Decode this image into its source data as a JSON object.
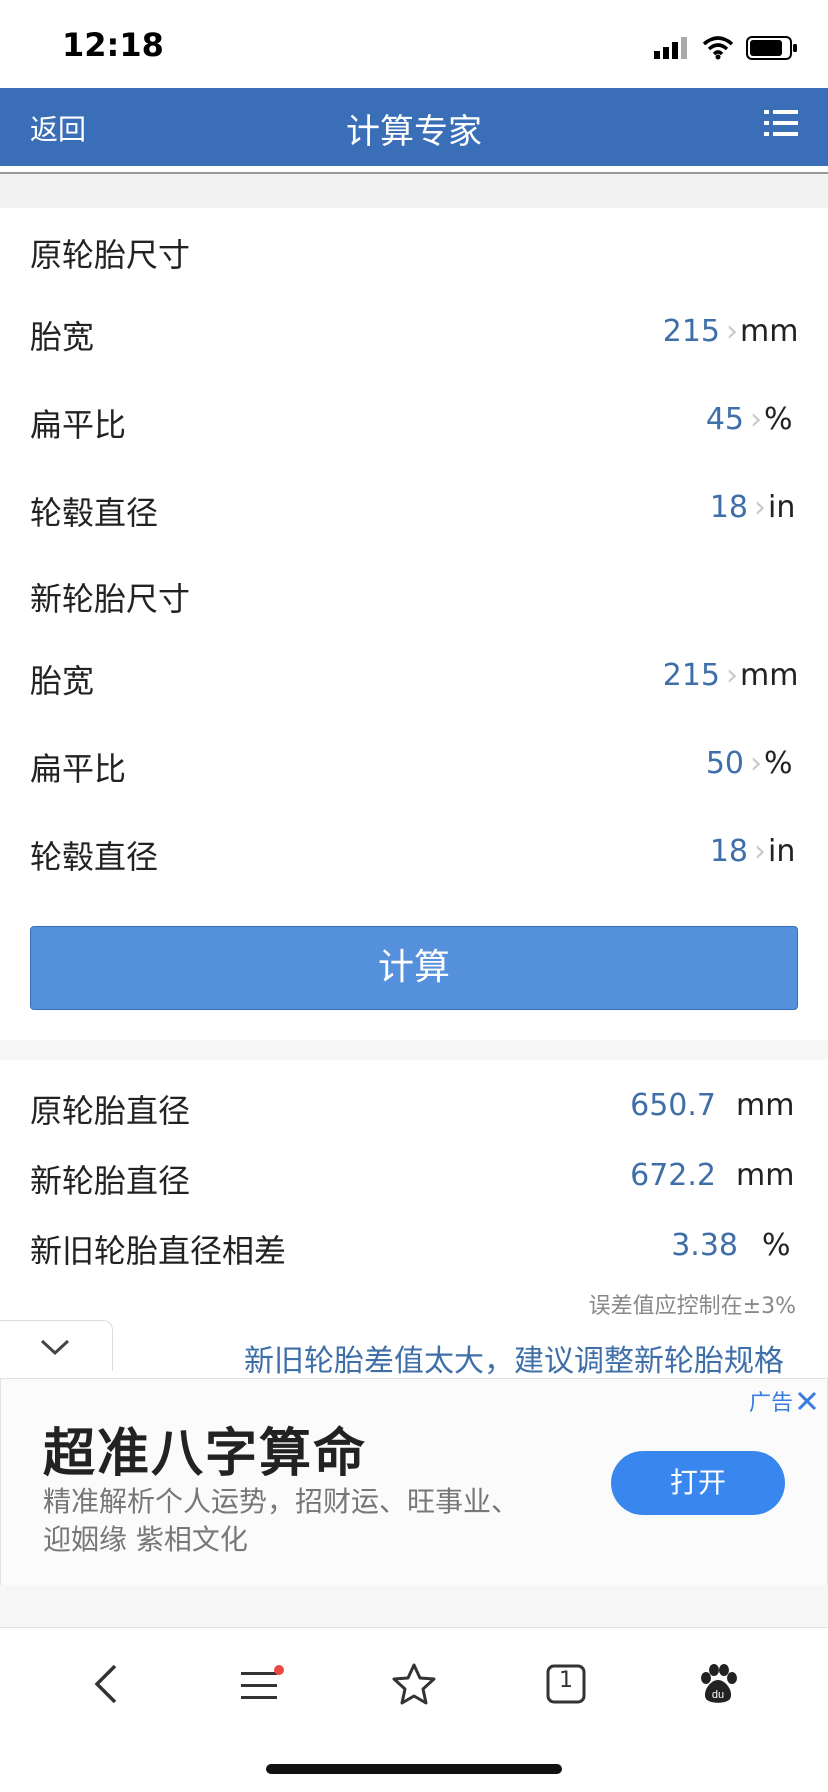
{
  "status": {
    "time": "12:18"
  },
  "nav": {
    "back": "返回",
    "title": "计算专家",
    "menu_icon": "list-icon"
  },
  "original": {
    "section_label": "原轮胎尺寸",
    "width": {
      "label": "胎宽",
      "value": "215",
      "unit": "mm"
    },
    "ratio": {
      "label": "扁平比",
      "value": "45",
      "unit": "%"
    },
    "rim": {
      "label": "轮毂直径",
      "value": "18",
      "unit": "in"
    }
  },
  "new": {
    "section_label": "新轮胎尺寸",
    "width": {
      "label": "胎宽",
      "value": "215",
      "unit": "mm"
    },
    "ratio": {
      "label": "扁平比",
      "value": "50",
      "unit": "%"
    },
    "rim": {
      "label": "轮毂直径",
      "value": "18",
      "unit": "in"
    }
  },
  "calc_button": "计算",
  "results": [
    {
      "label": "原轮胎直径",
      "value": "650.7",
      "unit": "mm"
    },
    {
      "label": "新轮胎直径",
      "value": "672.2",
      "unit": "mm"
    },
    {
      "label": "新旧轮胎直径相差",
      "value": "3.38",
      "unit": "%"
    }
  ],
  "tip": "误差值应控制在±3%",
  "warning": "新旧轮胎差值太大，建议调整新轮胎规格",
  "ad": {
    "tag": "广告",
    "title": "超准八字算命",
    "desc": "精准解析个人运势，招财运、旺事业、迎姻缘 紫相文化",
    "button": "打开"
  },
  "toolbar": {
    "tab_count": "1"
  },
  "colors": {
    "nav_bg": "#3a6fb8",
    "accent_text": "#3f6fa8",
    "button": "#5590dc",
    "ad_button": "#3a86ef"
  }
}
